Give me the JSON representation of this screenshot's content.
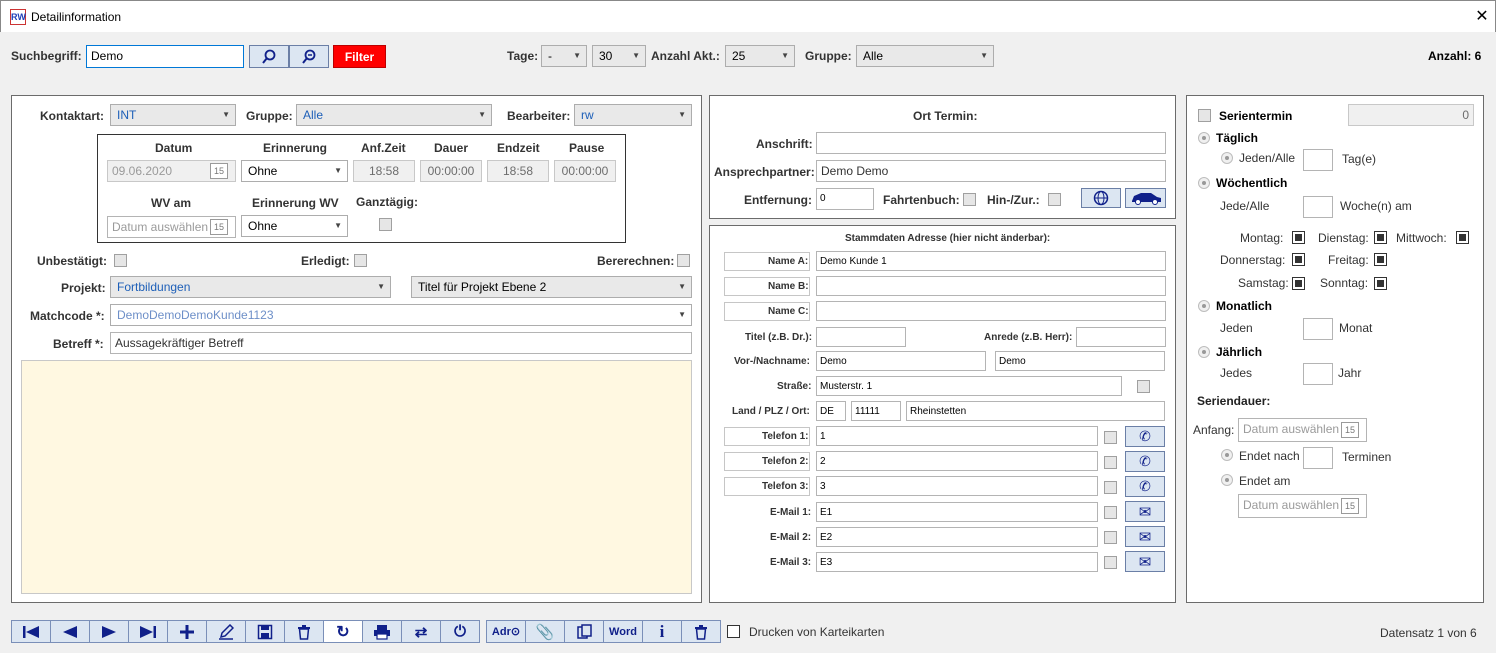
{
  "window": {
    "title": "Detailinformation",
    "logo": "RW",
    "close": "✕"
  },
  "search": {
    "label": "Suchbegriff:",
    "value": "Demo",
    "filter_label": "Filter",
    "tage_label": "Tage:",
    "tage_value": "-",
    "tage_value2": "30",
    "akt_label": "Anzahl Akt.:",
    "akt_value": "25",
    "gruppe_label": "Gruppe:",
    "gruppe_value": "Alle",
    "count_label": "Anzahl: 6"
  },
  "left": {
    "kontaktart_label": "Kontaktart:",
    "kontaktart_value": "INT",
    "gruppe_label": "Gruppe:",
    "gruppe_value": "Alle",
    "bearbeiter_label": "Bearbeiter:",
    "bearbeiter_value": "rw",
    "datum_label": "Datum",
    "datum_value": "09.06.2020",
    "erinnerung_label": "Erinnerung",
    "erinnerung_value": "Ohne",
    "anfzeit_label": "Anf.Zeit",
    "anfzeit_value": "18:58",
    "dauer_label": "Dauer",
    "dauer_value": "00:00:00",
    "endzeit_label": "Endzeit",
    "endzeit_value": "18:58",
    "pause_label": "Pause",
    "pause_value": "00:00:00",
    "wv_label": "WV am",
    "wv_placeholder": "Datum auswählen",
    "erinnerung_wv_label": "Erinnerung WV",
    "erinnerung_wv_value": "Ohne",
    "ganztaegig_label": "Ganztägig:",
    "unbestaetigt_label": "Unbestätigt:",
    "erledigt_label": "Erledigt:",
    "bererechnen_label": "Bererechnen:",
    "projekt_label": "Projekt:",
    "projekt_value": "Fortbildungen",
    "projekt2_value": "Titel für Projekt Ebene 2",
    "matchcode_label": "Matchcode *:",
    "matchcode_value": "DemoDemoDemoKunde1123",
    "betreff_label": "Betreff *:",
    "betreff_value": "Aussagekräftiger Betreff",
    "calendar_glyph": "15"
  },
  "ort": {
    "title": "Ort Termin:",
    "anschrift_label": "Anschrift:",
    "anschrift_value": "",
    "ansprech_label": "Ansprechpartner:",
    "ansprech_value": "Demo Demo",
    "entfernung_label": "Entfernung:",
    "entfernung_value": "0",
    "fahrtenbuch_label": "Fahrtenbuch:",
    "hinzur_label": "Hin-/Zur.:"
  },
  "stamm": {
    "title": "Stammdaten Adresse (hier nicht änderbar):",
    "name_a_label": "Name A:",
    "name_a": "Demo Kunde 1",
    "name_b_label": "Name B:",
    "name_c_label": "Name C:",
    "titel_label": "Titel (z.B. Dr.):",
    "anrede_label": "Anrede (z.B. Herr):",
    "vorname_label": "Vor-/Nachname:",
    "vorname": "Demo",
    "nachname": "Demo",
    "strasse_label": "Straße:",
    "strasse": "Musterstr. 1",
    "land_label": "Land / PLZ / Ort:",
    "land": "DE",
    "plz": "11111",
    "ort": "Rheinstetten",
    "tel1_label": "Telefon 1:",
    "tel1": "1",
    "tel2_label": "Telefon 2:",
    "tel2": "2",
    "tel3_label": "Telefon 3:",
    "tel3": "3",
    "mail1_label": "E-Mail 1:",
    "mail1": "E1",
    "mail2_label": "E-Mail 2:",
    "mail2": "E2",
    "mail3_label": "E-Mail 3:",
    "mail3": "E3"
  },
  "serie": {
    "serientermin_label": "Serientermin",
    "serientermin_value": "0",
    "taeglich": "Täglich",
    "jeden_alle": "Jeden/Alle",
    "tage": "Tag(e)",
    "woechentlich": "Wöchentlich",
    "jede_alle": "Jede/Alle",
    "wochen": "Woche(n) am",
    "montag": "Montag:",
    "dienstag": "Dienstag:",
    "mittwoch": "Mittwoch:",
    "donnerstag": "Donnerstag:",
    "freitag": "Freitag:",
    "samstag": "Samstag:",
    "sonntag": "Sonntag:",
    "monatlich": "Monatlich",
    "jeden": "Jeden",
    "monat": "Monat",
    "jaehrlich": "Jährlich",
    "jedes": "Jedes",
    "jahr": "Jahr",
    "seriendauer": "Seriendauer:",
    "anfang": "Anfang:",
    "anfang_placeholder": "Datum auswählen",
    "endet_nach": "Endet nach",
    "terminen": "Terminen",
    "endet_am": "Endet am",
    "endet_am_placeholder": "Datum auswählen"
  },
  "toolbar": {
    "adr": "Adr⊙",
    "word": "Word",
    "info": "i",
    "drucken_label": "Drucken von Karteikarten",
    "datensatz": "Datensatz 1 von 6"
  }
}
